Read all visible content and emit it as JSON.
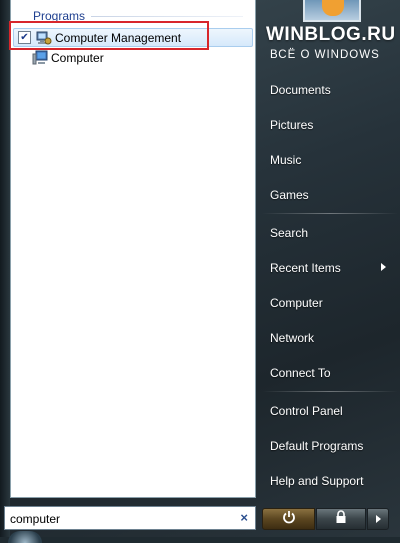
{
  "results": {
    "group_header": "Programs",
    "items": [
      {
        "label": "Computer Management",
        "checked": true,
        "icon": "computer-management-icon"
      },
      {
        "label": "Computer",
        "checked": false,
        "icon": "computer-icon"
      }
    ]
  },
  "search": {
    "value": "computer",
    "clear_symbol": "×"
  },
  "watermark": {
    "site": "WINBLOG.RU",
    "subtitle": "ВСЁ О WINDOWS"
  },
  "right_pane": {
    "documents": "Documents",
    "pictures": "Pictures",
    "music": "Music",
    "games": "Games",
    "search": "Search",
    "recent_items": "Recent Items",
    "computer": "Computer",
    "network": "Network",
    "connect_to": "Connect To",
    "control_panel": "Control Panel",
    "default_programs": "Default Programs",
    "help_and_support": "Help and Support"
  },
  "colors": {
    "highlight_box": "#d8262b",
    "header_text": "#1e3f8f",
    "power_button": "#5b4620"
  }
}
